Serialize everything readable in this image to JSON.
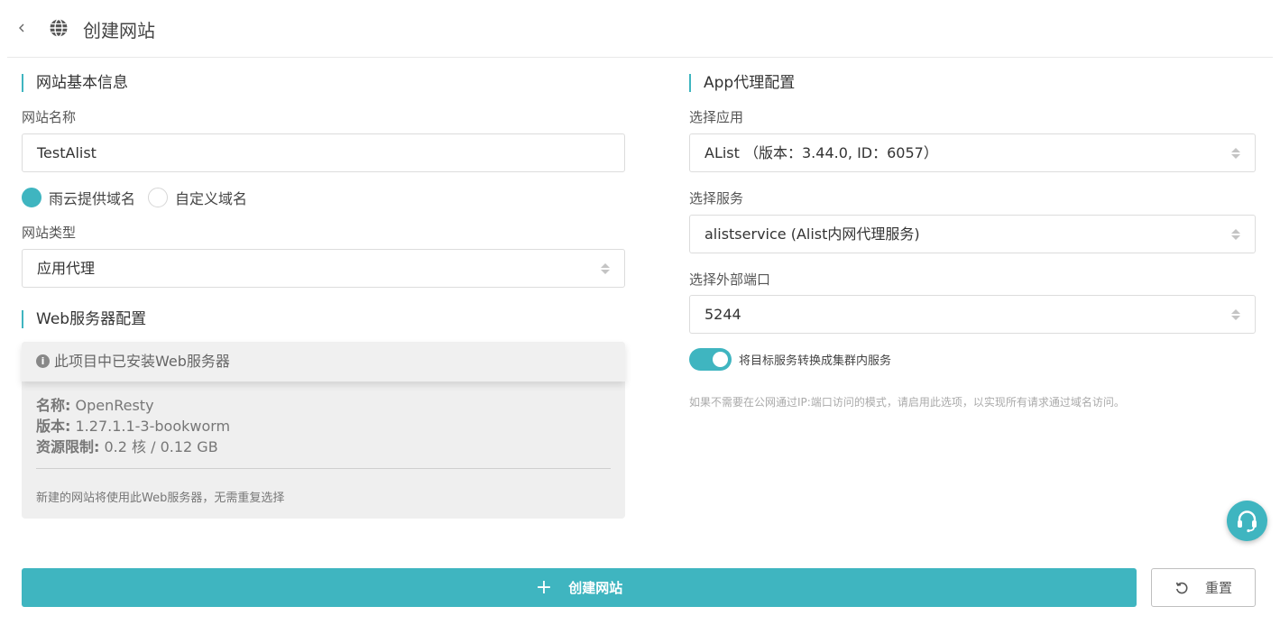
{
  "header": {
    "title": "创建网站"
  },
  "left": {
    "basic_section": "网站基本信息",
    "site_name_label": "网站名称",
    "site_name_value": "TestAlist",
    "domain_options": [
      "雨云提供域名",
      "自定义域名"
    ],
    "site_type_label": "网站类型",
    "site_type_value": "应用代理",
    "web_section": "Web服务器配置",
    "web_info": {
      "notice": "此项目中已安装Web服务器",
      "name_key": "名称:",
      "name_val": " OpenResty",
      "version_key": "版本:",
      "version_val": " 1.27.1.1-3-bookworm",
      "limit_key": "资源限制:",
      "limit_val": " 0.2 核 / 0.12 GB",
      "note": "新建的网站将使用此Web服务器，无需重复选择"
    }
  },
  "right": {
    "proxy_section": "App代理配置",
    "app_label": "选择应用",
    "app_value": "AList （版本：3.44.0, ID：6057）",
    "service_label": "选择服务",
    "service_value": "alistservice (Alist内网代理服务)",
    "port_label": "选择外部端口",
    "port_value": "5244",
    "toggle_label": "将目标服务转换成集群内服务",
    "toggle_on": true,
    "hint": "如果不需要在公网通过IP:端口访问的模式，请启用此选项，以实现所有请求通过域名访问。"
  },
  "actions": {
    "create": "创建网站",
    "reset": "重置"
  },
  "colors": {
    "accent": "#3fb5c0"
  }
}
